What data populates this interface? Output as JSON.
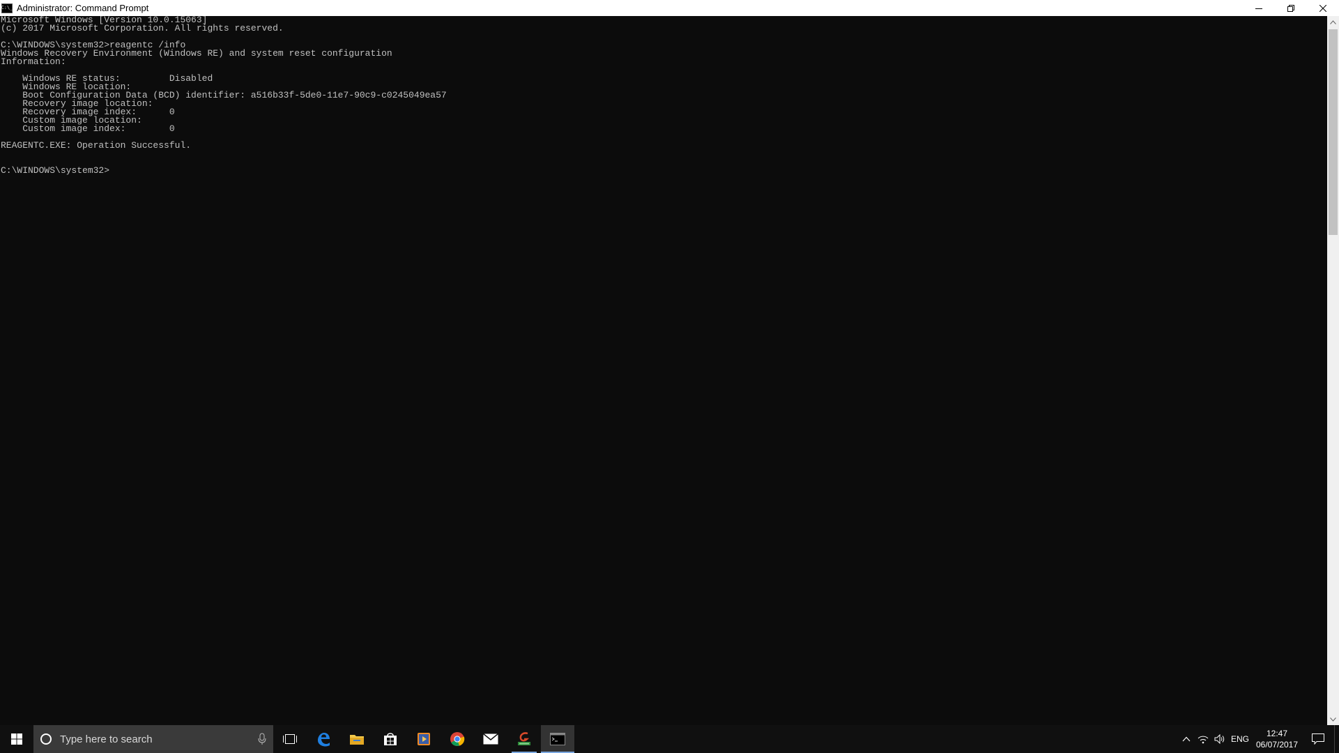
{
  "window": {
    "title": "Administrator: Command Prompt",
    "app_icon_text": "C:\\_"
  },
  "console": {
    "lines": [
      "Microsoft Windows [Version 10.0.15063]",
      "(c) 2017 Microsoft Corporation. All rights reserved.",
      "",
      "C:\\WINDOWS\\system32>reagentc /info",
      "Windows Recovery Environment (Windows RE) and system reset configuration",
      "Information:",
      "",
      "    Windows RE status:         Disabled",
      "    Windows RE location:",
      "    Boot Configuration Data (BCD) identifier: a516b33f-5de0-11e7-90c9-c0245049ea57",
      "    Recovery image location:",
      "    Recovery image index:      0",
      "    Custom image location:",
      "    Custom image index:        0",
      "",
      "REAGENTC.EXE: Operation Successful.",
      "",
      "",
      "C:\\WINDOWS\\system32>"
    ]
  },
  "taskbar": {
    "search_placeholder": "Type here to search",
    "apps": [
      "task-view",
      "edge",
      "file-explorer",
      "store",
      "media-player",
      "chrome",
      "mail",
      "gpu-tool",
      "command-prompt"
    ],
    "language": "ENG",
    "time": "12:47",
    "date": "06/07/2017"
  },
  "colors": {
    "console_bg": "#0c0c0c",
    "console_text": "#c0c0c0",
    "taskbar_bg": "#101010",
    "accent": "#7aa7e0"
  }
}
